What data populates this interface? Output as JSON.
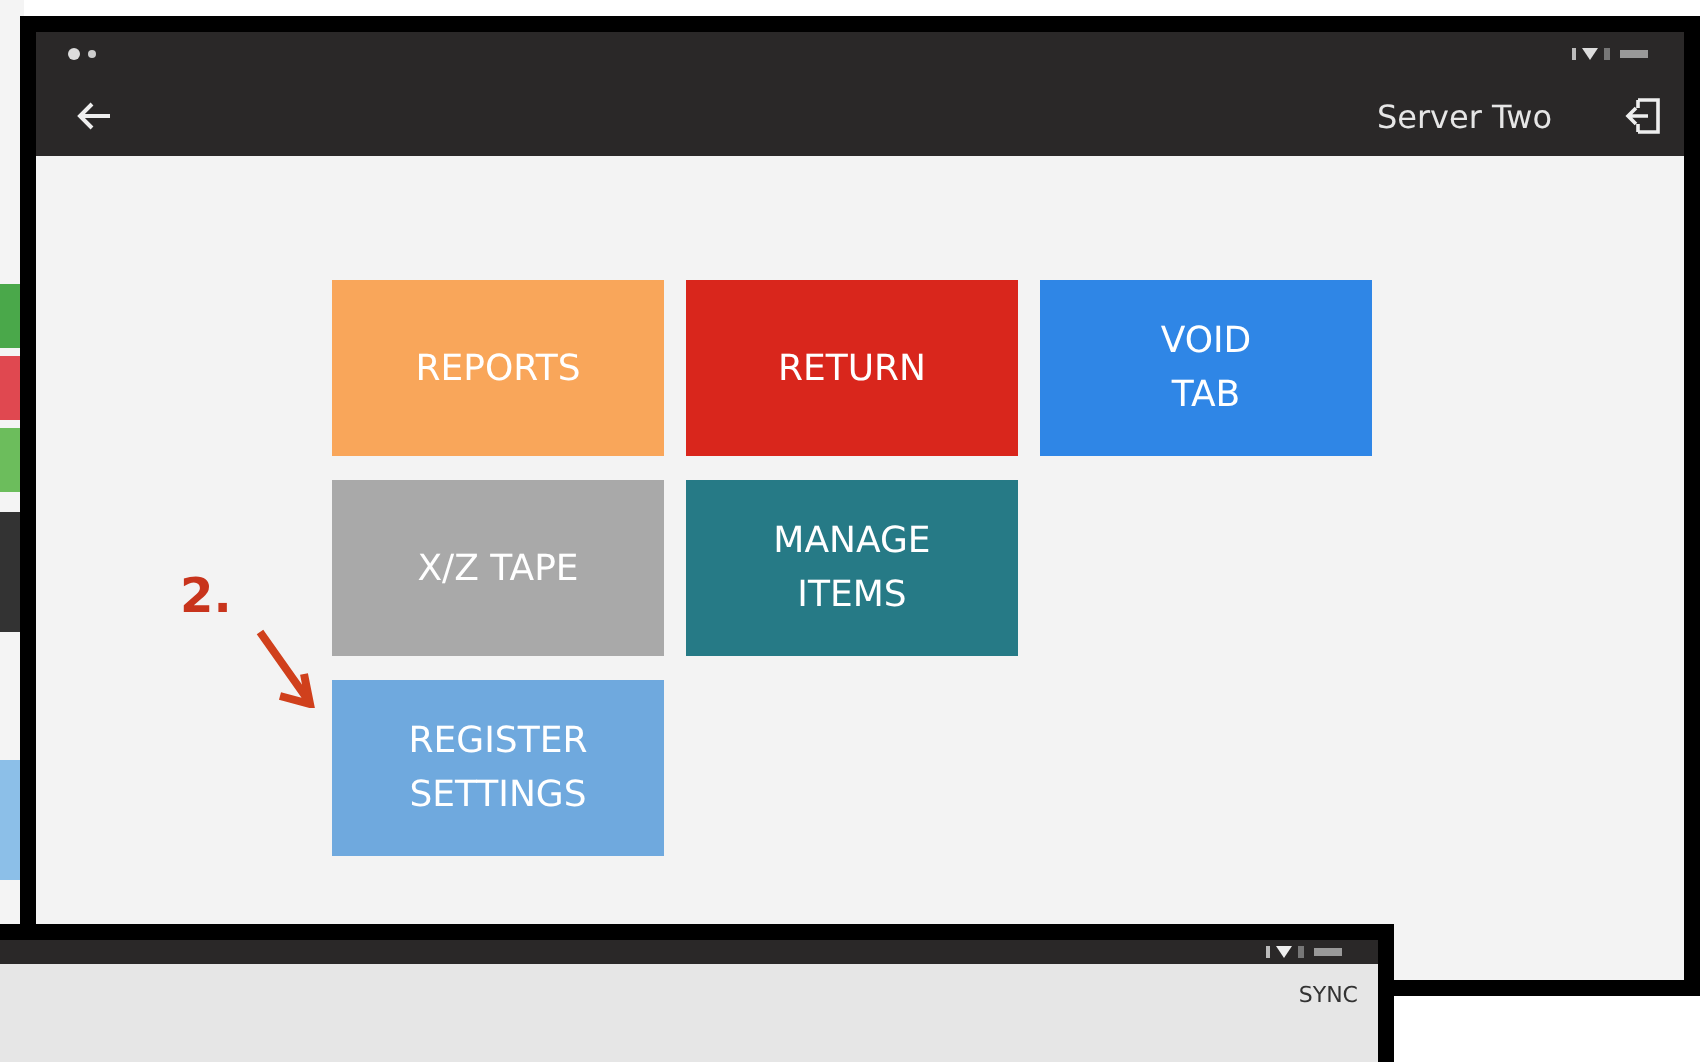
{
  "main_window": {
    "toolbar": {
      "user": "Server Two"
    },
    "tile_rows": [
      [
        {
          "label": "REPORTS",
          "color": "#f9a65a"
        },
        {
          "label": "RETURN",
          "color": "#d9261c"
        },
        {
          "label": "VOID\nTAB",
          "color": "#2f86e6"
        }
      ],
      [
        {
          "label": "X/Z TAPE",
          "color": "#a9a9a9"
        },
        {
          "label": "MANAGE\nITEMS",
          "color": "#267a86"
        }
      ],
      [
        {
          "label": "REGISTER\nSETTINGS",
          "color": "#6fa9de"
        }
      ]
    ]
  },
  "annotation": {
    "label": "2."
  },
  "bottom_window": {
    "toolbar": {
      "action": "SYNC"
    }
  }
}
